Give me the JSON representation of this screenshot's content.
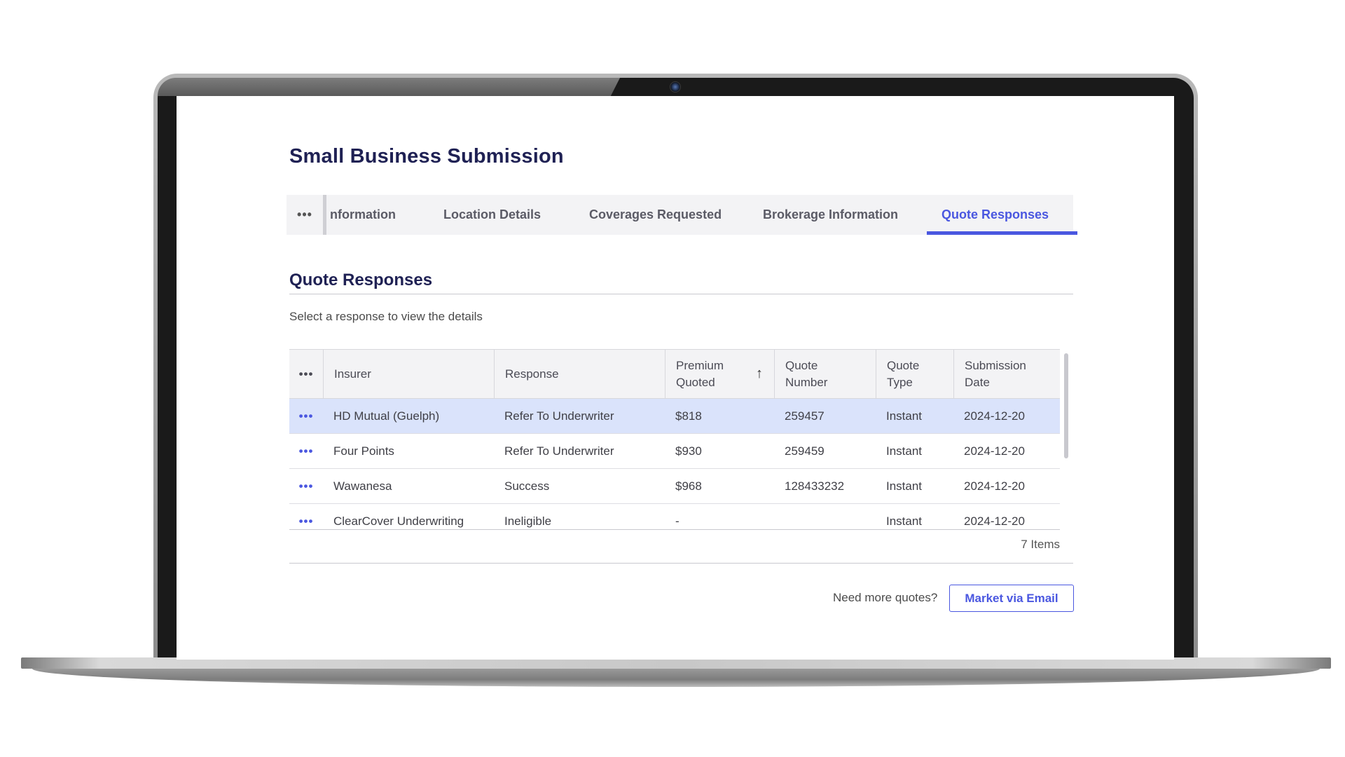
{
  "page": {
    "title": "Small Business Submission"
  },
  "tabs": {
    "more_label": "•••",
    "items": [
      {
        "label": "Information",
        "visible_label": "nformation"
      },
      {
        "label": "Location Details"
      },
      {
        "label": "Coverages Requested"
      },
      {
        "label": "Brokerage Information"
      },
      {
        "label": "Quote Responses",
        "active": true
      }
    ]
  },
  "section": {
    "title": "Quote Responses",
    "helper": "Select a response to view the details"
  },
  "table": {
    "more_label": "•••",
    "sort_icon": "↑",
    "columns": [
      {
        "key": "insurer",
        "label": "Insurer"
      },
      {
        "key": "response",
        "label": "Response"
      },
      {
        "key": "premium",
        "label": "Premium Quoted",
        "sorted": "ascending"
      },
      {
        "key": "quote_number",
        "label": "Quote Number"
      },
      {
        "key": "quote_type",
        "label": "Quote Type"
      },
      {
        "key": "submission_date",
        "label": "Submission Date"
      }
    ],
    "rows": [
      {
        "insurer": "HD Mutual (Guelph)",
        "response": "Refer To Underwriter",
        "premium": "$818",
        "quote_number": "259457",
        "quote_type": "Instant",
        "submission_date": "2024-12-20",
        "selected": true
      },
      {
        "insurer": "Four Points",
        "response": "Refer To Underwriter",
        "premium": "$930",
        "quote_number": "259459",
        "quote_type": "Instant",
        "submission_date": "2024-12-20"
      },
      {
        "insurer": "Wawanesa",
        "response": "Success",
        "premium": "$968",
        "quote_number": "128433232",
        "quote_type": "Instant",
        "submission_date": "2024-12-20"
      },
      {
        "insurer": "ClearCover Underwriting",
        "response": "Ineligible",
        "premium": "-",
        "quote_number": "",
        "quote_type": "Instant",
        "submission_date": "2024-12-20"
      }
    ],
    "items_count": "7 Items"
  },
  "footer": {
    "need_more": "Need more quotes?",
    "market_button": "Market via Email"
  },
  "colors": {
    "accent": "#4a57e0",
    "title": "#1f2154",
    "selected_row": "#dae3fb"
  }
}
